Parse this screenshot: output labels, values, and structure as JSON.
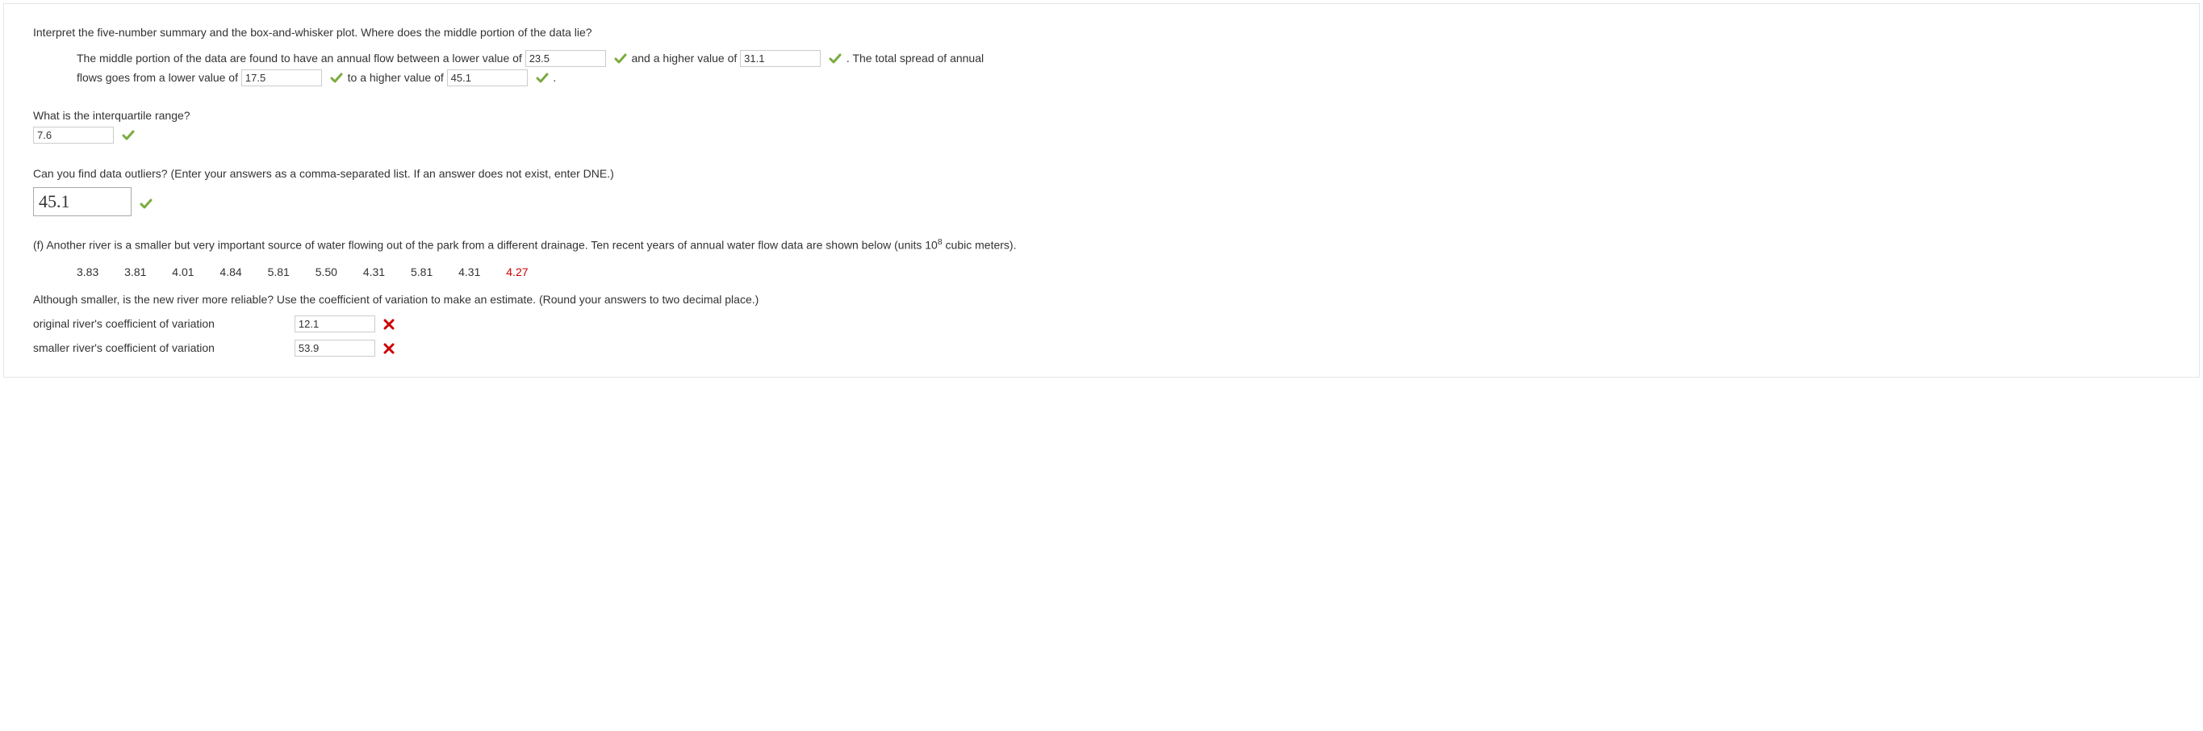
{
  "q_interpret": "Interpret the five-number summary and the box-and-whisker plot. Where does the middle portion of the data lie?",
  "sentence1_a": "The middle portion of the data are found to have an annual flow between a lower value of",
  "ans1": "23.5",
  "sentence1_b": "and a higher value of",
  "ans2": "31.1",
  "sentence1_c": ". The total spread of annual",
  "sentence2_a": "flows goes from a lower value of",
  "ans3": "17.5",
  "sentence2_b": "to a higher value of",
  "ans4": "45.1",
  "sentence2_c": ".",
  "q_iqr": "What is the interquartile range?",
  "ans_iqr": "7.6",
  "q_outliers": "Can you find data outliers? (Enter your answers as a comma-separated list. If an answer does not exist, enter DNE.)",
  "ans_outliers": "45.1",
  "partf_a": "(f) Another river is a smaller but very important source of water flowing out of the park from a different drainage. Ten recent years of annual water flow data are shown below (units 10",
  "partf_sup": "8",
  "partf_b": " cubic meters).",
  "data": [
    "3.83",
    "3.81",
    "4.01",
    "4.84",
    "5.81",
    "5.50",
    "4.31",
    "5.81",
    "4.31",
    "4.27"
  ],
  "partf_q": "Although smaller, is the new river more reliable? Use the coefficient of variation to make an estimate. (Round your answers to two decimal place.)",
  "cv_orig_label": "original river's coefficient of variation",
  "cv_orig_val": "12.1",
  "cv_small_label": "smaller river's coefficient of variation",
  "cv_small_val": "53.9"
}
